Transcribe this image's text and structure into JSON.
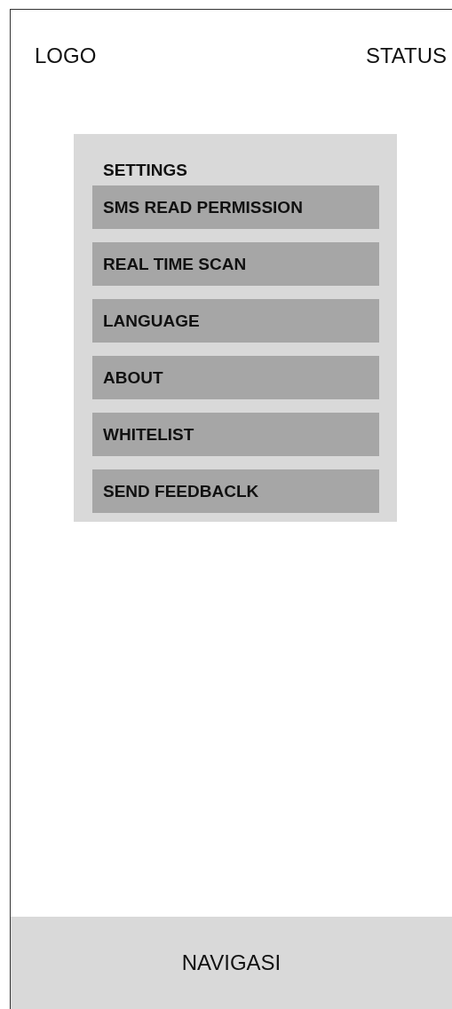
{
  "header": {
    "logo": "LOGO",
    "status": "STATUS"
  },
  "settings": {
    "title": "SETTINGS",
    "items": [
      {
        "label": "SMS READ PERMISSION"
      },
      {
        "label": "REAL TIME SCAN"
      },
      {
        "label": "LANGUAGE"
      },
      {
        "label": "ABOUT"
      },
      {
        "label": "WHITELIST"
      },
      {
        "label": "SEND FEEDBACLK"
      }
    ]
  },
  "navigation": {
    "label": "NAVIGASI"
  }
}
